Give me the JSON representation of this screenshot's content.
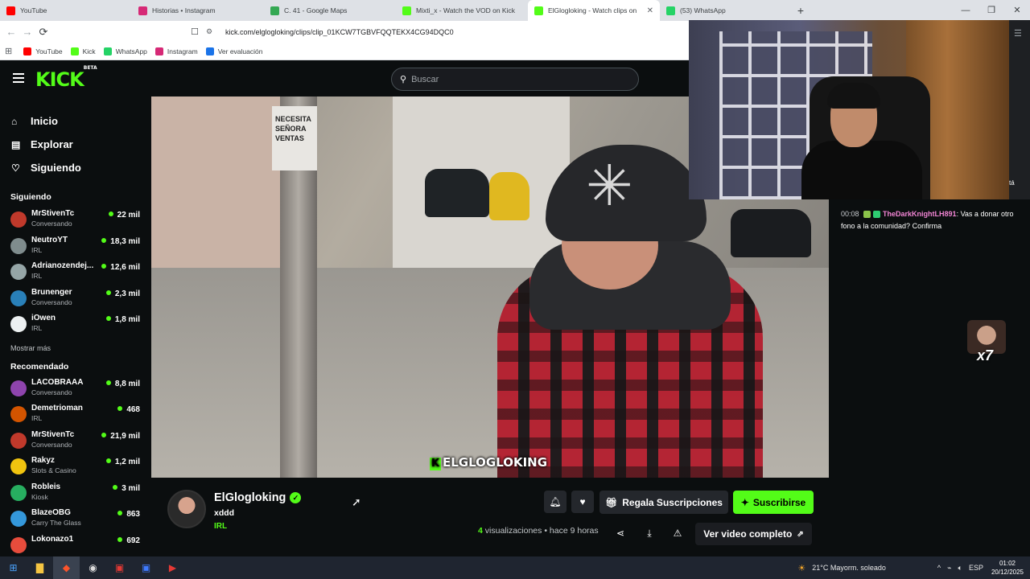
{
  "browser": {
    "tabs": [
      {
        "title": "YouTube",
        "color": "#ff0000",
        "active": false
      },
      {
        "title": "Historias • Instagram",
        "color": "#d62976",
        "active": false
      },
      {
        "title": "C. 41 - Google Maps",
        "color": "#34a853",
        "active": false
      },
      {
        "title": "Mixti_x - Watch the VOD on Kick",
        "color": "#53fc18",
        "active": false
      },
      {
        "title": "ElGlogloking - Watch clips on",
        "color": "#53fc18",
        "active": true
      },
      {
        "title": "(53) WhatsApp",
        "color": "#25d366",
        "active": false
      }
    ],
    "url": "kick.com/elglogloking/clips/clip_01KCW7TGBVFQQTEKX4CG94DQC0",
    "bookmarks": [
      {
        "label": "YouTube",
        "color": "#ff0000"
      },
      {
        "label": "Kick",
        "color": "#53fc18"
      },
      {
        "label": "WhatsApp",
        "color": "#25d366"
      },
      {
        "label": "Instagram",
        "color": "#d62976"
      },
      {
        "label": "Ver evaluación",
        "color": "#1a73e8"
      }
    ]
  },
  "kick": {
    "logo": "KICK",
    "logo_tag": "BETA",
    "search_placeholder": "Buscar",
    "nav": [
      {
        "label": "Inicio",
        "icon": "home-icon"
      },
      {
        "label": "Explorar",
        "icon": "compass-icon"
      },
      {
        "label": "Siguiendo",
        "icon": "heart-icon"
      }
    ],
    "following_title": "Siguiendo",
    "following": [
      {
        "name": "MrStivenTc",
        "category": "Conversando",
        "viewers": "22 mil",
        "color": "#c0392b"
      },
      {
        "name": "NeutroYT",
        "category": "IRL",
        "viewers": "18,3 mil",
        "color": "#7f8c8d"
      },
      {
        "name": "Adrianozendej...",
        "category": "IRL",
        "viewers": "12,6 mil",
        "color": "#95a5a6"
      },
      {
        "name": "Brunenger",
        "category": "Conversando",
        "viewers": "2,3 mil",
        "color": "#2980b9"
      },
      {
        "name": "iOwen",
        "category": "IRL",
        "viewers": "1,8 mil",
        "color": "#ecf0f1"
      }
    ],
    "show_more": "Mostrar más",
    "recommended_title": "Recomendado",
    "recommended": [
      {
        "name": "LACOBRAAA",
        "category": "Conversando",
        "viewers": "8,8 mil",
        "color": "#8e44ad"
      },
      {
        "name": "Demetrioman",
        "category": "IRL",
        "viewers": "468",
        "color": "#d35400"
      },
      {
        "name": "MrStivenTc",
        "category": "Conversando",
        "viewers": "21,9 mil",
        "color": "#c0392b"
      },
      {
        "name": "Rakyz",
        "category": "Slots & Casino",
        "viewers": "1,2 mil",
        "color": "#f1c40f"
      },
      {
        "name": "Robleis",
        "category": "Kiosk",
        "viewers": "3 mil",
        "color": "#27ae60"
      },
      {
        "name": "BlazeOBG",
        "category": "Carry The Glass",
        "viewers": "863",
        "color": "#3498db"
      },
      {
        "name": "Lokonazo1",
        "category": "",
        "viewers": "692",
        "color": "#e74c3c"
      }
    ],
    "video": {
      "sign_text": "NECESITA SEÑORA VENTAS",
      "watermark": "ELGLOGLOKING",
      "watermark_k": "K"
    },
    "channel": {
      "name": "ElGlogloking",
      "clip_title": "xddd",
      "category": "IRL",
      "gift_label": "Regala Suscripciones",
      "subscribe_label": "Suscribirse",
      "views_count": "4",
      "views_label": "visualizaciones",
      "time_ago": "• hace 9 horas",
      "full_video_label": "Ver video completo"
    },
    "chat": {
      "time": "00:08",
      "user": "TheDarkKnightLH891",
      "message": "Vas a donar otro fono a la comunidad? Confirma",
      "emote_count": "x7"
    }
  },
  "overlay_side": {
    "text": "tá"
  },
  "taskbar": {
    "weather": "21°C  Mayorm. soleado",
    "lang": "ESP",
    "time": "01:02",
    "date": "20/12/2025"
  }
}
